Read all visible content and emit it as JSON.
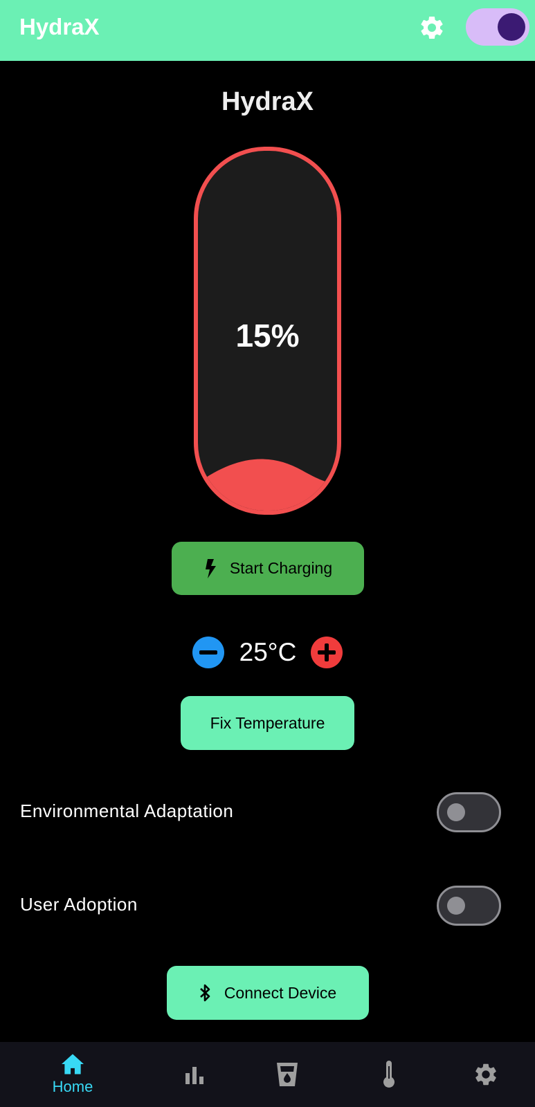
{
  "app_bar": {
    "title": "HydraX",
    "theme_toggle_on": true
  },
  "page": {
    "title": "HydraX"
  },
  "battery": {
    "percent_label": "15%",
    "level_fraction": 0.15,
    "color": "#f24f4f"
  },
  "charge_button": {
    "label": "Start Charging",
    "icon": "bolt-icon",
    "color": "#4caf50"
  },
  "temperature": {
    "value": "25°C",
    "decrease_icon": "minus-icon",
    "increase_icon": "plus-icon"
  },
  "fix_button": {
    "label": "Fix Temperature"
  },
  "settings": [
    {
      "label": "Environmental Adaptation",
      "enabled": false
    },
    {
      "label": "User Adoption",
      "enabled": false
    }
  ],
  "connect_button": {
    "label": "Connect Device",
    "icon": "bluetooth-icon"
  },
  "bottom_nav": {
    "items": [
      {
        "icon": "home-icon",
        "label": "Home",
        "active": true
      },
      {
        "icon": "bar-chart-icon",
        "label": "",
        "active": false
      },
      {
        "icon": "water-glass-icon",
        "label": "",
        "active": false
      },
      {
        "icon": "thermometer-icon",
        "label": "",
        "active": false
      },
      {
        "icon": "gear-icon",
        "label": "",
        "active": false
      }
    ]
  },
  "colors": {
    "accent": "#6bf0b4",
    "nav_active": "#38d9f5",
    "background": "#000000"
  }
}
